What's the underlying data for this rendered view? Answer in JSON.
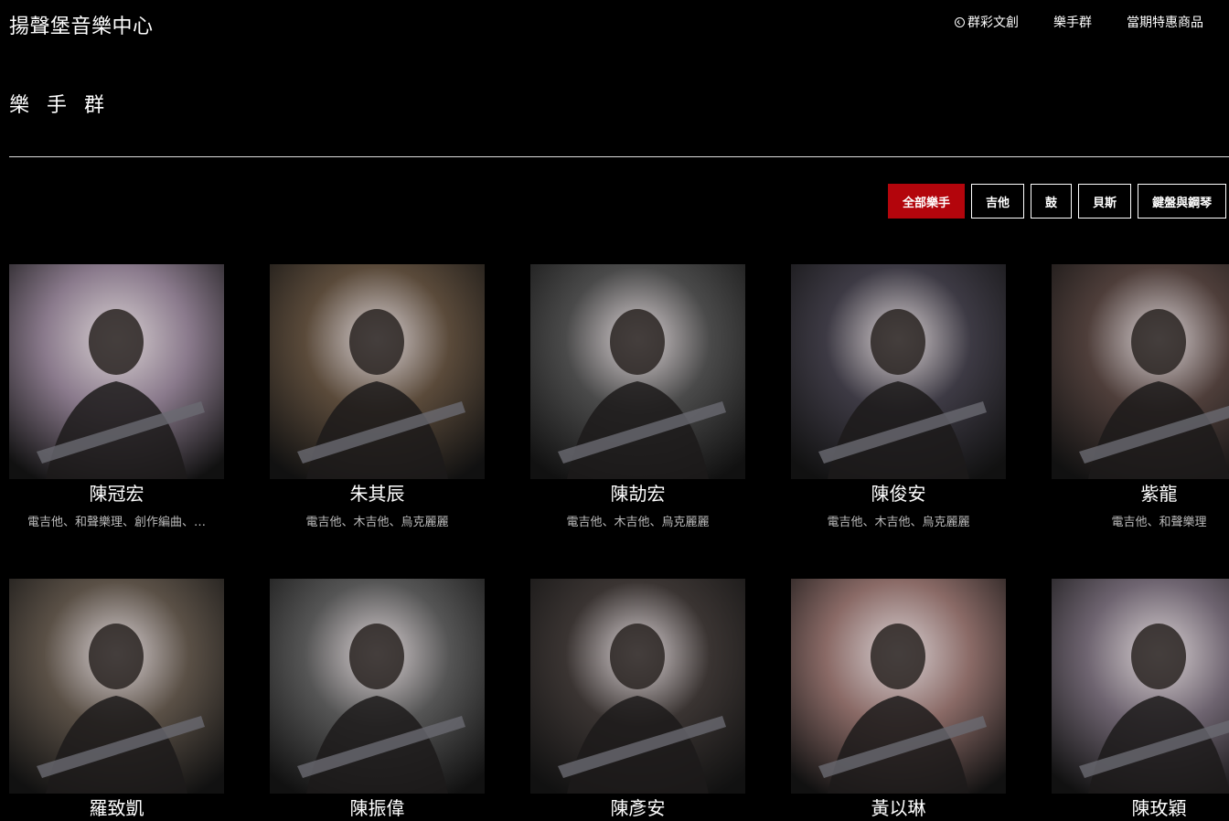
{
  "header": {
    "site_title": "揚聲堡音樂中心",
    "nav": [
      {
        "label": "群彩文創",
        "icon": "circle-check-icon"
      },
      {
        "label": "樂手群"
      },
      {
        "label": "當期特惠商品"
      }
    ]
  },
  "page_title": "樂 手 群",
  "filters": [
    {
      "label": "全部樂手",
      "active": true
    },
    {
      "label": "吉他",
      "active": false
    },
    {
      "label": "鼓",
      "active": false
    },
    {
      "label": "貝斯",
      "active": false
    },
    {
      "label": "鍵盤與鋼琴",
      "active": false
    }
  ],
  "colors": {
    "accent": "#b3050c",
    "background": "#000000"
  },
  "musicians": [
    {
      "name": "陳冠宏",
      "tags": "電吉他、和聲樂理、創作編曲、…",
      "tone": "#8a7a8c"
    },
    {
      "name": "朱其辰",
      "tags": "電吉他、木吉他、烏克麗麗",
      "tone": "#5a4a3a"
    },
    {
      "name": "陳劼宏",
      "tags": "電吉他、木吉他、烏克麗麗",
      "tone": "#4a4a4a"
    },
    {
      "name": "陳俊安",
      "tags": "電吉他、木吉他、烏克麗麗",
      "tone": "#3d3a44"
    },
    {
      "name": "紫龍",
      "tags": "電吉他、和聲樂理",
      "tone": "#4e3e3a"
    },
    {
      "name": "羅致凱",
      "tags": "",
      "tone": "#5a5046"
    },
    {
      "name": "陳振偉",
      "tags": "",
      "tone": "#555555"
    },
    {
      "name": "陳彥安",
      "tags": "",
      "tone": "#3a3432"
    },
    {
      "name": "黃以琳",
      "tags": "",
      "tone": "#8a6a66"
    },
    {
      "name": "陳玫穎",
      "tags": "",
      "tone": "#6e6470"
    }
  ]
}
